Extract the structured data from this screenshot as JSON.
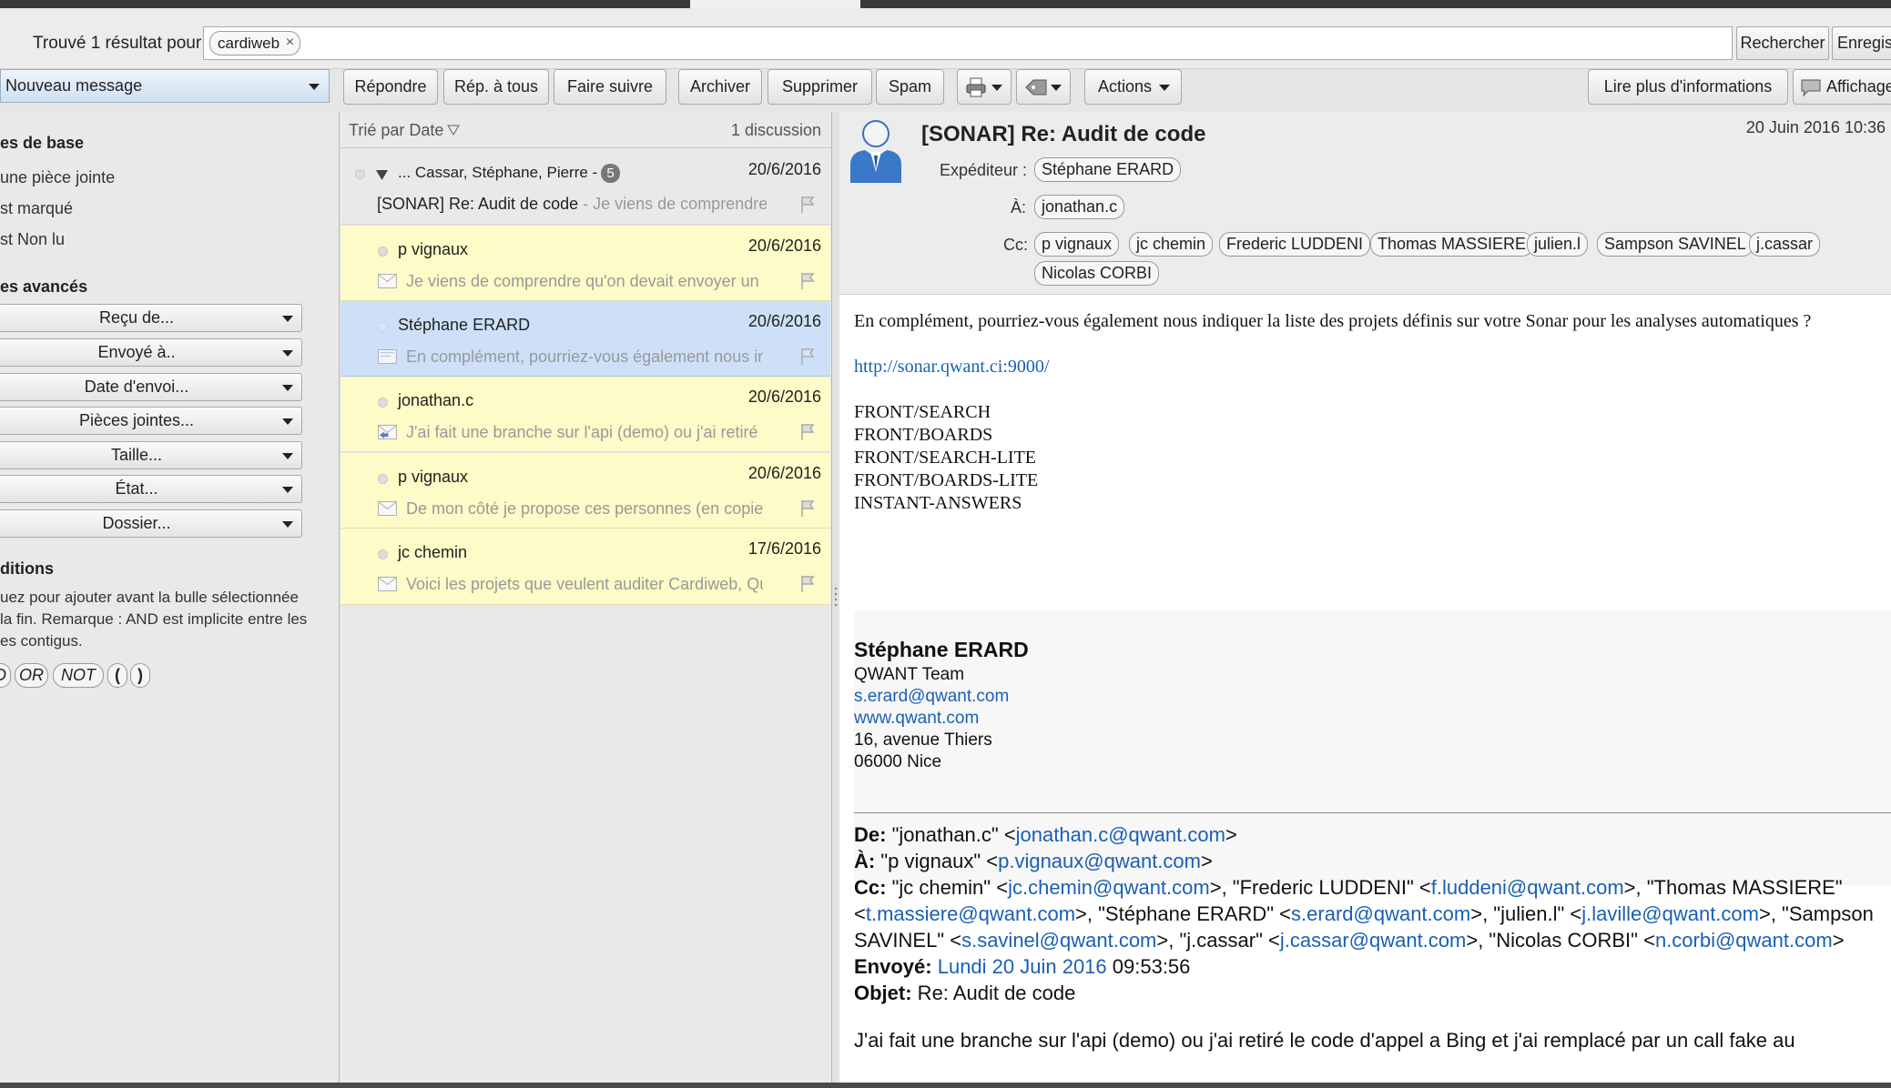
{
  "search": {
    "found_label": "Trouvé 1 résultat pour :",
    "chip": "cardiweb",
    "chip_close": "×",
    "search_button": "Rechercher",
    "save_button": "Enregis"
  },
  "toolbar": {
    "new_message": "Nouveau message",
    "reply": "Répondre",
    "reply_all": "Rép. à tous",
    "forward": "Faire suivre",
    "archive": "Archiver",
    "delete": "Supprimer",
    "spam": "Spam",
    "actions": "Actions",
    "more_info": "Lire plus d'informations",
    "display": "Affichage"
  },
  "sidebar": {
    "basic_header": "es de base",
    "basic_items": [
      "une pièce jointe",
      "st marqué",
      "st Non lu"
    ],
    "advanced_header": "es avancés",
    "filters": [
      "Reçu de...",
      "Envoyé à..",
      "Date d'envoi...",
      "Pièces jointes...",
      "Taille...",
      "État...",
      "Dossier..."
    ],
    "conditions_header": "ditions",
    "conditions_text": [
      "uez pour ajouter avant la bulle sélectionnée",
      " la fin. Remarque : AND est implicite entre les",
      "es contigus."
    ],
    "operators": [
      "D",
      "OR",
      "NOT",
      "(",
      ")"
    ]
  },
  "list": {
    "sort_label": "Trié par Date",
    "count_label": "1 discussion",
    "thread": {
      "participants": "... Cassar, Stéphane, Pierre -",
      "count": "5",
      "date": "20/6/2016",
      "subject": "[SONAR] Re: Audit de code",
      "snippet": " - Je viens de comprendre qu'"
    },
    "rows": [
      {
        "sender": "p vignaux",
        "date": "20/6/2016",
        "snippet": "Je viens de comprendre qu'on devait envoyer un gars",
        "selected": false
      },
      {
        "sender": "Stéphane ERARD",
        "date": "20/6/2016",
        "snippet": "En complément, pourriez-vous également nous indiquer",
        "selected": true
      },
      {
        "sender": "jonathan.c",
        "date": "20/6/2016",
        "snippet": "J'ai fait une branche sur l'api (demo) ou j'ai retiré le code",
        "selected": false
      },
      {
        "sender": "p vignaux",
        "date": "20/6/2016",
        "snippet": "De mon côté je propose ces personnes (en copie du",
        "selected": false
      },
      {
        "sender": "jc chemin",
        "date": "17/6/2016",
        "snippet": "Voici les projets que veulent auditer Cardiweb, Qu'est",
        "selected": false
      }
    ]
  },
  "message": {
    "subject": "[SONAR] Re: Audit de code",
    "date": "20 Juin 2016 10:36",
    "from_label": "Expéditeur :",
    "from": "Stéphane ERARD",
    "to_label": "À:",
    "to": "jonathan.c",
    "cc_label": "Cc:",
    "cc": [
      "p vignaux",
      "jc chemin",
      "Frederic LUDDENI",
      "Thomas MASSIERE",
      "julien.l",
      "Sampson SAVINEL",
      "j.cassar",
      "Nicolas CORBI"
    ],
    "intro": "En complément, pourriez-vous également nous indiquer la liste des projets définis sur votre Sonar pour les analyses automatiques ?",
    "sonar_link": "http://sonar.qwant.ci:9000/",
    "projects": [
      "FRONT/SEARCH",
      "FRONT/BOARDS",
      "FRONT/SEARCH-LITE",
      "FRONT/BOARDS-LITE",
      "INSTANT-ANSWERS"
    ],
    "signature": {
      "name": "Stéphane ERARD",
      "team": "QWANT Team",
      "email": "s.erard@qwant.com",
      "web": "www.qwant.com",
      "address1": "16, avenue Thiers",
      "address2": "06000 Nice"
    },
    "quoted": {
      "de_label": "De:",
      "de_name": " \"jonathan.c\" <",
      "de_email": "jonathan.c@qwant.com",
      "a_label": "À:",
      "a_name": " \"p vignaux\" <",
      "a_email": "p.vignaux@qwant.com",
      "cc_label": "Cc:",
      "cc_1": " \"jc chemin\" <",
      "cc_1_email": "jc.chemin@qwant.com",
      "cc_2": ">, \"Frederic LUDDENI\" <",
      "cc_2_email": "f.luddeni@qwant.com",
      "cc_3": ">, \"Thomas MASSIERE\" <",
      "cc_3_email": "t.massiere@qwant.com",
      "cc_4": ">, \"Stéphane ERARD\" <",
      "cc_4_email": "s.erard@qwant.com",
      "cc_5": ">, \"julien.l\" <",
      "cc_5_email": "j.laville@qwant.com",
      "cc_6": ">, \"Sampson SAVINEL\" <",
      "cc_6_email": "s.savinel@qwant.com",
      "cc_7": ">, \"j.cassar\" <",
      "cc_7_email": "j.cassar@qwant.com",
      "cc_8": ">, \"Nicolas CORBI\" <",
      "cc_8_email": "n.corbi@qwant.com",
      "cc_end": ">",
      "sent_label": "Envoyé:",
      "sent_date": "Lundi 20 Juin 2016",
      "sent_time": " 09:53:56",
      "subject_label": "Objet:",
      "subject": " Re: Audit de code",
      "body_start": "J'ai fait une branche sur l'api (demo) ou j'ai retiré le code d'appel a Bing et j'ai remplacé  par un call fake au"
    }
  },
  "colors": {
    "selected_row": "#cde0f7",
    "unread_row": "#fdfbc7",
    "link": "#1a5fb4"
  }
}
